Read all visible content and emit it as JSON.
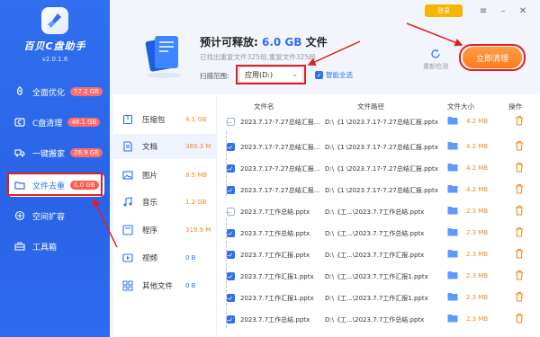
{
  "app": {
    "name": "百贝C盘助手",
    "version": "v2.0.1.6"
  },
  "titlebar": {
    "login_label": "登录",
    "menu_icon": "menu-icon",
    "minimize_icon": "minimize-icon",
    "close_icon": "close-icon"
  },
  "sidebar": {
    "items": [
      {
        "label": "全面优化",
        "badge": "57.2 GB",
        "icon": "rocket-icon"
      },
      {
        "label": "C盘清理",
        "badge": "48.1 GB",
        "icon": "drive-c-icon"
      },
      {
        "label": "一键搬家",
        "badge": "26.9 GB",
        "icon": "truck-icon"
      },
      {
        "label": "文件去重",
        "badge": "6.0 GB",
        "icon": "folder-icon"
      },
      {
        "label": "空间扩容",
        "badge": "",
        "icon": "expand-icon"
      },
      {
        "label": "工具箱",
        "badge": "",
        "icon": "toolbox-icon"
      }
    ],
    "active_index": 3
  },
  "header": {
    "title_prefix": "预计可释放:",
    "title_amount": "6.0 GB",
    "title_suffix": "文件",
    "subtitle": "已找出重复文件325组,重复文件325组",
    "scope_label": "扫描范围:",
    "scope_value": "应用(D:)",
    "smart_select_label": "智能全选",
    "rescan_label": "重新检测",
    "clean_label": "立即清理"
  },
  "categories": [
    {
      "label": "压缩包",
      "size": "4.1 GB",
      "icon": "archive-icon"
    },
    {
      "label": "文档",
      "size": "369.3 M",
      "icon": "document-icon"
    },
    {
      "label": "图片",
      "size": "8.5 MB",
      "icon": "image-icon"
    },
    {
      "label": "音乐",
      "size": "1.2 GB",
      "icon": "music-icon"
    },
    {
      "label": "程序",
      "size": "319.9 M",
      "icon": "program-icon"
    },
    {
      "label": "视频",
      "size": "0 B",
      "icon": "video-icon"
    },
    {
      "label": "其他文件",
      "size": "0 B",
      "icon": "other-file-icon"
    }
  ],
  "active_category": 1,
  "table": {
    "headers": {
      "name": "文件名",
      "path": "文件路径",
      "size": "文件大小",
      "action": "操作"
    },
    "rows": [
      {
        "checked": false,
        "name": "2023.7.17-7.27总结汇报...",
        "path": "D:\\《1 \\2023.7.17-7.27总结汇报.pptx",
        "size": "4.2 MB"
      },
      {
        "checked": true,
        "name": "2023.7.17-7.27总结汇报...",
        "path": "D:\\《1 \\2023.7.17-7.27总结汇报.pptx",
        "size": "4.2 MB"
      },
      {
        "checked": true,
        "name": "2023.7.17-7.27总结汇报...",
        "path": "D:\\《1 \\2023.7.17-7.27总结汇报.pptx",
        "size": "4.2 MB"
      },
      {
        "checked": true,
        "name": "2023.7.17-7.27总结汇报...",
        "path": "D:\\《1 \\2023.7.17-7.27总结汇报.pptx",
        "size": "4.2 MB"
      },
      {
        "checked": false,
        "name": "2023.7.7工作总结.pptx",
        "path": "D:\\《工...\\2023.7.7工作总结.pptx",
        "size": "2.3 MB"
      },
      {
        "checked": true,
        "name": "2023.7.7工作总结.pptx",
        "path": "D:\\《工...\\2023.7.7工作总结.pptx",
        "size": "2.3 MB"
      },
      {
        "checked": true,
        "name": "2023.7.7工作汇报.pptx",
        "path": "D:\\《工...\\2023.7.7工作汇报.pptx",
        "size": "2.3 MB"
      },
      {
        "checked": true,
        "name": "2023.7.7工作汇报1.pptx",
        "path": "D:\\《工...\\2023.7.7工作汇报1.pptx",
        "size": "2.3 MB"
      },
      {
        "checked": true,
        "name": "2023.7.7工作汇报1.pptx",
        "path": "D:\\《工...\\2023.7.7工作汇报1.pptx",
        "size": "2.3 MB"
      },
      {
        "checked": true,
        "name": "2023.7.7工作总结.pptx",
        "path": "D:\\《工...\\2023.7.7工作总结.pptx",
        "size": "2.3 MB"
      }
    ]
  },
  "colors": {
    "accent": "#2f6ff0",
    "orange": "#ff7a1a",
    "badge_red": "#ff5a4a",
    "highlight_red": "#e02020"
  }
}
